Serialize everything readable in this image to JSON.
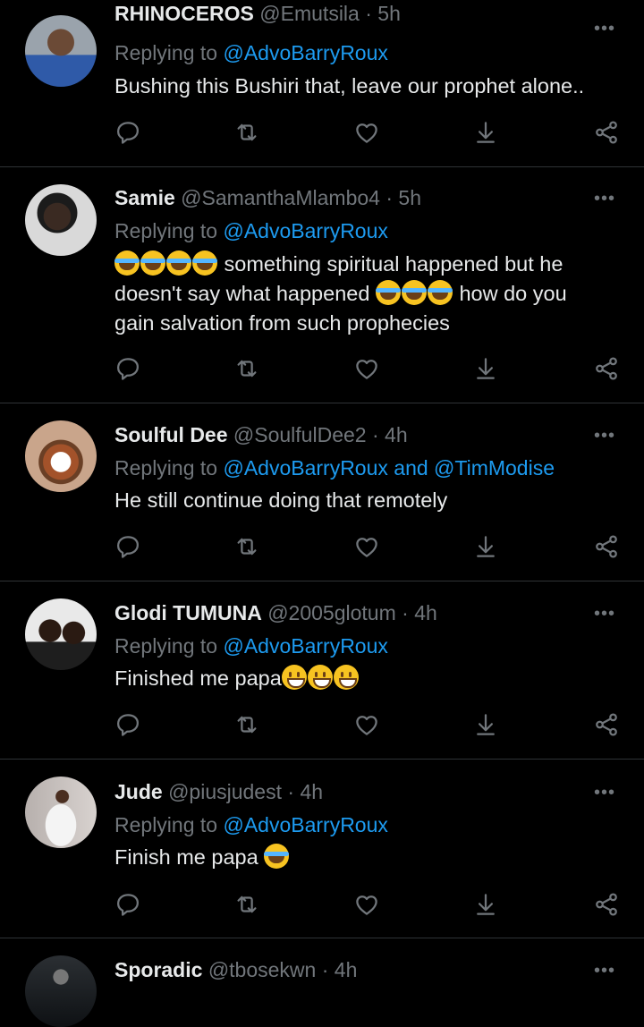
{
  "tweets": [
    {
      "name": "RHINOCEROS",
      "handle": "@Emutsila",
      "time": "5h",
      "replying_prefix": "Replying to",
      "replying_to": "@AdvoBarryRoux",
      "text": "Bushing this Bushiri that, leave our prophet alone.."
    },
    {
      "name": "Samie",
      "handle": "@SamanthaMlambo4",
      "time": "5h",
      "replying_prefix": "Replying to",
      "replying_to": "@AdvoBarryRoux",
      "text_1": "something spiritual happened but he",
      "text_2": "doesn't say what happened",
      "text_3": "how do you",
      "text_4": "gain salvation from such prophecies"
    },
    {
      "name": "Soulful Dee",
      "handle": "@SoulfulDee2",
      "time": "4h",
      "replying_prefix": "Replying to",
      "replying_to": "@AdvoBarryRoux and @TimModise",
      "text": "He still continue doing that remotely"
    },
    {
      "name": "Glodi TUMUNA",
      "handle": "@2005glotum",
      "time": "4h",
      "replying_prefix": "Replying to",
      "replying_to": "@AdvoBarryRoux",
      "text": "Finished me papa"
    },
    {
      "name": "Jude",
      "handle": "@piusjudest",
      "time": "4h",
      "replying_prefix": "Replying to",
      "replying_to": "@AdvoBarryRoux",
      "text": "Finish me papa"
    },
    {
      "name": "Sporadic",
      "handle": "@tbosekwn",
      "time": "4h"
    }
  ],
  "sep": "·",
  "more_label": "•••",
  "colors": {
    "background": "#000000",
    "text": "#e7e9ea",
    "muted": "#71767b",
    "link": "#1d9bf0",
    "divider": "#2f3336"
  },
  "icons": [
    "reply-icon",
    "retweet-icon",
    "like-icon",
    "download-icon",
    "share-icon"
  ]
}
